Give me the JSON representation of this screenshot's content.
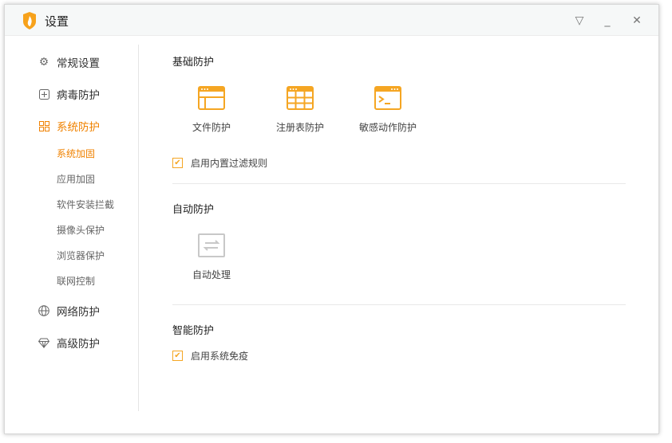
{
  "window": {
    "title": "设置"
  },
  "titlebar": {
    "menu_icon": "▽",
    "minimize_icon": "_",
    "close_icon": "✕"
  },
  "sidebar": {
    "items": [
      {
        "label": "常规设置",
        "icon": "gear-icon"
      },
      {
        "label": "病毒防护",
        "icon": "plus-box-icon"
      },
      {
        "label": "系统防护",
        "icon": "grid-icon",
        "active": true
      },
      {
        "label": "网络防护",
        "icon": "globe-icon"
      },
      {
        "label": "高级防护",
        "icon": "diamond-icon"
      }
    ],
    "subitems": [
      {
        "label": "系统加固",
        "active": true
      },
      {
        "label": "应用加固"
      },
      {
        "label": "软件安装拦截"
      },
      {
        "label": "摄像头保护"
      },
      {
        "label": "浏览器保护"
      },
      {
        "label": "联网控制"
      }
    ]
  },
  "main": {
    "basic": {
      "title": "基础防护",
      "tiles": [
        {
          "label": "文件防护"
        },
        {
          "label": "注册表防护"
        },
        {
          "label": "敏感动作防护"
        }
      ],
      "checkbox": {
        "label": "启用内置过滤规则",
        "checked": true
      }
    },
    "auto": {
      "title": "自动防护",
      "tiles": [
        {
          "label": "自动处理"
        }
      ]
    },
    "smart": {
      "title": "智能防护",
      "checkbox": {
        "label": "启用系统免疫",
        "checked": true
      }
    }
  },
  "colors": {
    "accent": "#f08200",
    "icon": "#f5a623"
  }
}
